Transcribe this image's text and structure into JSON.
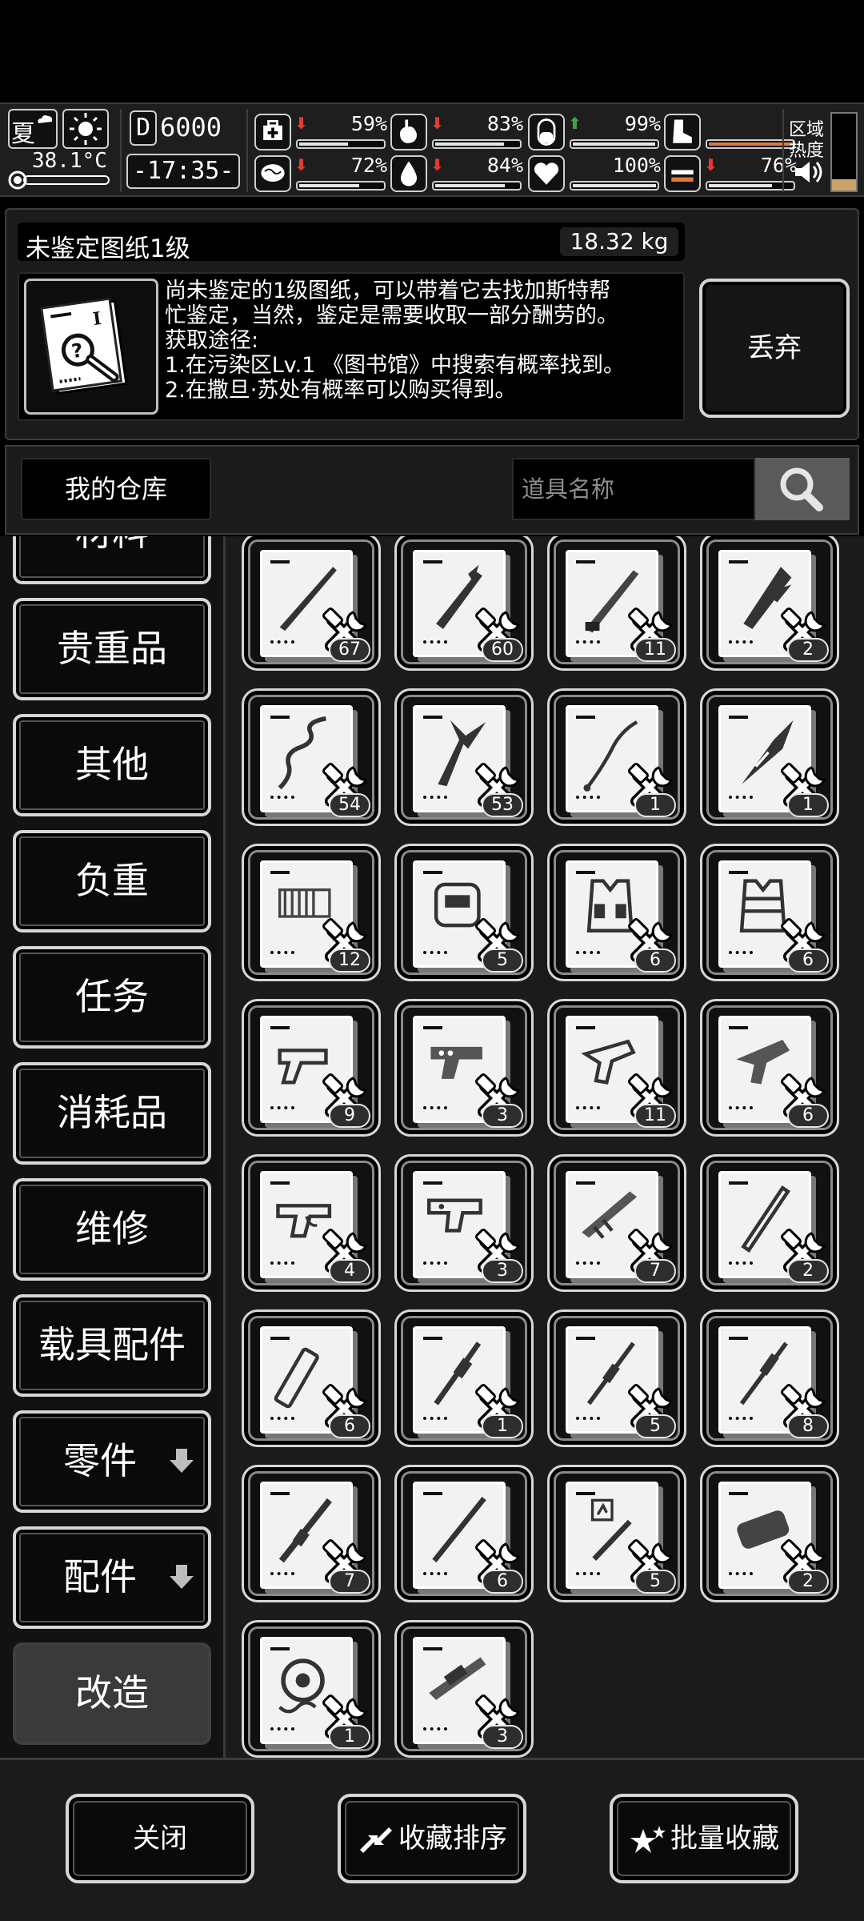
{
  "status": {
    "season": "夏",
    "temperature": "38.1°C",
    "day_counter": "6000",
    "day_prefix": "D",
    "clock": "-17:35-",
    "region_label_1": "区域",
    "region_label_2": "热度",
    "stats": [
      {
        "name": "health",
        "icon": "medkit-icon",
        "trend": "down",
        "percent": "59%",
        "level": 0.59
      },
      {
        "name": "hunger",
        "icon": "stomach-icon",
        "trend": "down",
        "percent": "83%",
        "level": 0.83
      },
      {
        "name": "energy",
        "icon": "pill-icon",
        "trend": "up",
        "percent": "99%",
        "level": 0.99
      },
      {
        "name": "stamina",
        "icon": "boot-icon",
        "trend": "none",
        "percent": "",
        "level": 1.0
      },
      {
        "name": "sanity",
        "icon": "brain-icon",
        "trend": "down",
        "percent": "72%",
        "level": 0.72
      },
      {
        "name": "thirst",
        "icon": "water-drop-icon",
        "trend": "down",
        "percent": "84%",
        "level": 0.84
      },
      {
        "name": "mood",
        "icon": "heart-icon",
        "trend": "none",
        "percent": "100%",
        "level": 1.0
      },
      {
        "name": "load",
        "icon": "weight-icon",
        "trend": "down",
        "percent": "76%",
        "level": 0.76
      }
    ]
  },
  "item": {
    "name": "未鉴定图纸1级",
    "weight": "18.32 kg",
    "description": [
      "尚未鉴定的1级图纸，可以带着它去找加斯特帮",
      "忙鉴定，当然，鉴定是需要收取一部分酬劳的。",
      "获取途径:",
      "1.在污染区Lv.1 《图书馆》中搜索有概率找到。",
      "2.在撒旦·苏处有概率可以购买得到。"
    ],
    "discard_label": "丢弃"
  },
  "warehouse": {
    "label": "我的仓库",
    "search_placeholder": "道具名称"
  },
  "categories": [
    {
      "label": "材料",
      "arrow": false,
      "active": false
    },
    {
      "label": "贵重品",
      "arrow": false,
      "active": false
    },
    {
      "label": "其他",
      "arrow": false,
      "active": false
    },
    {
      "label": "负重",
      "arrow": false,
      "active": false
    },
    {
      "label": "任务",
      "arrow": false,
      "active": false
    },
    {
      "label": "消耗品",
      "arrow": false,
      "active": false
    },
    {
      "label": "维修",
      "arrow": false,
      "active": false
    },
    {
      "label": "载具配件",
      "arrow": false,
      "active": false
    },
    {
      "label": "零件",
      "arrow": true,
      "active": false
    },
    {
      "label": "配件",
      "arrow": true,
      "active": false
    },
    {
      "label": "改造",
      "arrow": false,
      "active": true
    }
  ],
  "blueprints": [
    {
      "icon": "dagger-blueprint-icon",
      "count": "67"
    },
    {
      "icon": "spiked-blade-blueprint-icon",
      "count": "60"
    },
    {
      "icon": "knife-blueprint-icon",
      "count": "11"
    },
    {
      "icon": "claw-blade-blueprint-icon",
      "count": "2"
    },
    {
      "icon": "wavy-sword-blueprint-icon",
      "count": "54"
    },
    {
      "icon": "fork-blade-blueprint-icon",
      "count": "53"
    },
    {
      "icon": "whip-blueprint-icon",
      "count": "1"
    },
    {
      "icon": "drill-blade-blueprint-icon",
      "count": "1"
    },
    {
      "icon": "ammo-belt-blueprint-icon",
      "count": "12"
    },
    {
      "icon": "armor-plate-blueprint-icon",
      "count": "5"
    },
    {
      "icon": "tactical-vest-blueprint-icon",
      "count": "6"
    },
    {
      "icon": "life-vest-blueprint-icon",
      "count": "6"
    },
    {
      "icon": "pistol-frame-blueprint-icon",
      "count": "9"
    },
    {
      "icon": "pistol-slide-blueprint-icon",
      "count": "3"
    },
    {
      "icon": "smg-frame-blueprint-icon",
      "count": "11"
    },
    {
      "icon": "rifle-frame-blueprint-icon",
      "count": "6"
    },
    {
      "icon": "receiver-blueprint-icon",
      "count": "4"
    },
    {
      "icon": "upper-receiver-blueprint-icon",
      "count": "3"
    },
    {
      "icon": "rifle-body-blueprint-icon",
      "count": "7"
    },
    {
      "icon": "barrel-blueprint-icon",
      "count": "2"
    },
    {
      "icon": "suppressor-blueprint-icon",
      "count": "6"
    },
    {
      "icon": "long-barrel-blueprint-icon",
      "count": "1"
    },
    {
      "icon": "sniper-barrel-blueprint-icon",
      "count": "5"
    },
    {
      "icon": "rifle-barrel-blueprint-icon",
      "count": "8"
    },
    {
      "icon": "scope-rail-blueprint-icon",
      "count": "7"
    },
    {
      "icon": "rod-blueprint-icon",
      "count": "6"
    },
    {
      "icon": "battery-blueprint-icon",
      "count": "5"
    },
    {
      "icon": "magazine-blueprint-icon",
      "count": "2"
    },
    {
      "icon": "gear-chain-blueprint-icon",
      "count": "1"
    },
    {
      "icon": "rifle-stock-blueprint-icon",
      "count": "3"
    }
  ],
  "footer": {
    "close_label": "关闭",
    "sort_label": "收藏排序",
    "batch_label": "批量收藏"
  },
  "colors": {
    "background": "#1b1b1b",
    "frame": "#d7d7d7",
    "trend_down": "#e53935",
    "trend_up": "#43a047",
    "heat_bar": "#c9a36a"
  }
}
